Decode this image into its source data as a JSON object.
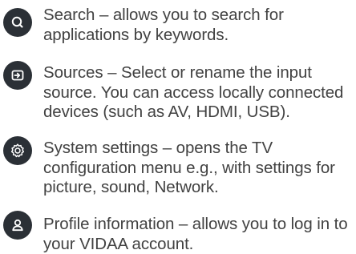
{
  "items": [
    {
      "icon": "search-icon",
      "text": "Search – allows you to search for applications by keywords."
    },
    {
      "icon": "input-source-icon",
      "text": "Sources – Select or rename the input source. You can access locally connected devices (such as AV, HDMI, USB)."
    },
    {
      "icon": "gear-icon",
      "text": "System settings – opens the TV configuration menu e.g., with settings for picture, sound, Network."
    },
    {
      "icon": "profile-icon",
      "text": "Profile information – allows you to log in to your VIDAA account."
    }
  ],
  "colors": {
    "icon_background": "#2b3036",
    "icon_foreground": "#ffffff",
    "text": "#424242"
  }
}
